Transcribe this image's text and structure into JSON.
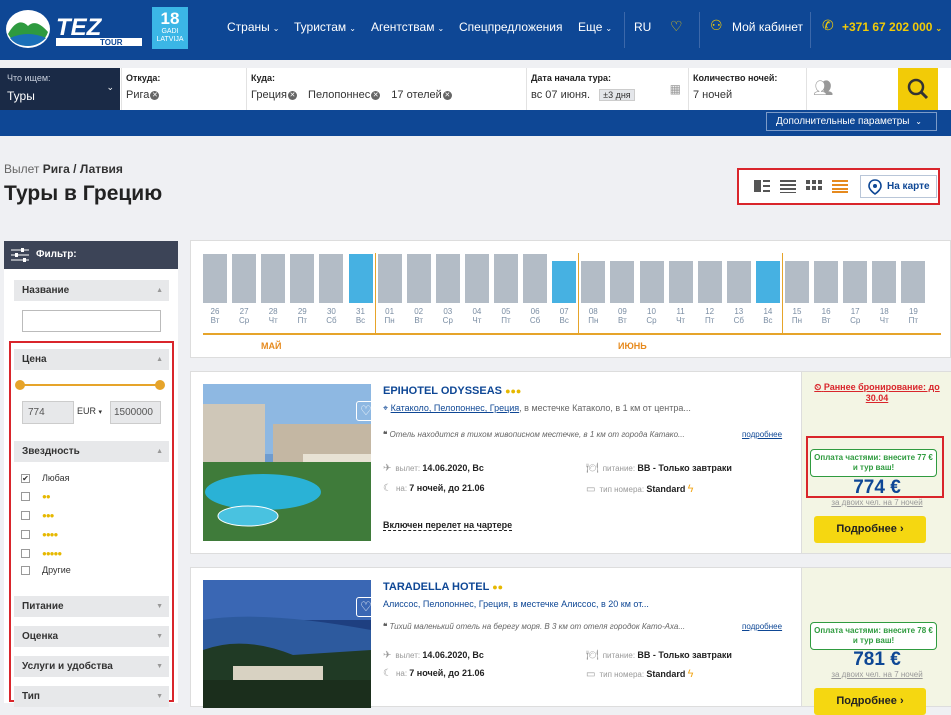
{
  "header": {
    "logo_text": "TEZ TOUR",
    "anniversary_num": "18",
    "anniversary_word": "GADI",
    "anniversary_country": "LATVIJA",
    "nav": [
      "Страны",
      "Туристам",
      "Агентствам",
      "Спецпредложения",
      "Еще"
    ],
    "lang": "RU",
    "cabinet": "Мой кабинет",
    "phone": "+371 67 202 000"
  },
  "search": {
    "what_label": "Что ищем:",
    "what_value": "Туры",
    "from_label": "Откуда:",
    "from_value": "Рига",
    "to_label": "Куда:",
    "to_values": [
      "Греция",
      "Пелопоннес",
      "17 отелей"
    ],
    "date_label": "Дата начала тура:",
    "date_value": "вс 07 июня.",
    "date_flex": "±3 дня",
    "nights_label": "Количество ночей:",
    "nights_value": "7 ночей",
    "advanced": "Дополнительные параметры"
  },
  "breadcrumb": {
    "prefix": "Вылет",
    "city": "Рига",
    "sep": "/",
    "country": "Латвия"
  },
  "page_title": "Туры в Грецию",
  "views": {
    "map_label": "На карте"
  },
  "filter": {
    "title": "Фильтр:",
    "name_section": "Название",
    "price_section": "Цена",
    "price_min": "774",
    "currency": "EUR",
    "price_max": "1500000",
    "stars_section": "Звездность",
    "star_any": "Любая",
    "star_other": "Другие",
    "meal_section": "Питание",
    "rating_section": "Оценка",
    "services_section": "Услуги и удобства",
    "type_section": "Тип"
  },
  "calendar": {
    "months": [
      "МАЙ",
      "ИЮНЬ"
    ],
    "days": [
      {
        "d": "26",
        "w": "Вт",
        "v": 0.82,
        "s": false
      },
      {
        "d": "27",
        "w": "Ср",
        "v": 0.82,
        "s": false
      },
      {
        "d": "28",
        "w": "Чт",
        "v": 0.82,
        "s": false
      },
      {
        "d": "29",
        "w": "Пт",
        "v": 0.82,
        "s": false
      },
      {
        "d": "30",
        "w": "Сб",
        "v": 0.82,
        "s": false
      },
      {
        "d": "31",
        "w": "Вс",
        "v": 0.82,
        "s": true
      },
      {
        "d": "01",
        "w": "Пн",
        "v": 0.82,
        "s": false
      },
      {
        "d": "02",
        "w": "Вт",
        "v": 0.82,
        "s": false
      },
      {
        "d": "03",
        "w": "Ср",
        "v": 0.82,
        "s": false
      },
      {
        "d": "04",
        "w": "Чт",
        "v": 0.82,
        "s": false
      },
      {
        "d": "05",
        "w": "Пт",
        "v": 0.82,
        "s": false
      },
      {
        "d": "06",
        "w": "Сб",
        "v": 0.82,
        "s": false
      },
      {
        "d": "07",
        "w": "Вс",
        "v": 0.7,
        "s": true
      },
      {
        "d": "08",
        "w": "Пн",
        "v": 0.7,
        "s": false
      },
      {
        "d": "09",
        "w": "Вт",
        "v": 0.7,
        "s": false
      },
      {
        "d": "10",
        "w": "Ср",
        "v": 0.7,
        "s": false
      },
      {
        "d": "11",
        "w": "Чт",
        "v": 0.7,
        "s": false
      },
      {
        "d": "12",
        "w": "Пт",
        "v": 0.7,
        "s": false
      },
      {
        "d": "13",
        "w": "Сб",
        "v": 0.7,
        "s": false
      },
      {
        "d": "14",
        "w": "Вс",
        "v": 0.7,
        "s": true
      },
      {
        "d": "15",
        "w": "Пн",
        "v": 0.7,
        "s": false
      },
      {
        "d": "16",
        "w": "Вт",
        "v": 0.7,
        "s": false
      },
      {
        "d": "17",
        "w": "Ср",
        "v": 0.7,
        "s": false
      },
      {
        "d": "18",
        "w": "Чт",
        "v": 0.7,
        "s": false
      },
      {
        "d": "19",
        "w": "Пт",
        "v": 0.7,
        "s": false
      }
    ]
  },
  "hotels": [
    {
      "name": "EPIHOTEL ODYSSEAS",
      "stars": 3,
      "location_link": "Катаколо, Пелопоннес, Греция",
      "location_rest": ", в местечке Катаколо, в 1 км от центра...",
      "desc": "Отель находится в тихом живописном местечке, в 1 км от города Катако...",
      "more": "подробнее",
      "dep_label": "вылет:",
      "dep_value": "14.06.2020, Вс",
      "nights_label": "на:",
      "nights_value": "7 ночей, до 21.06",
      "meal_label": "питание:",
      "meal_value": "BB - Только завтраки",
      "room_label": "тип номера:",
      "room_value": "Standard",
      "charter": "Включен перелет на чартере",
      "early": "Раннее бронирование: до 30.04",
      "installment": "Оплата частями: внесите 77 € и тур ваш!",
      "price": "774 €",
      "price_note": "за двоих чел. на 7 ночей",
      "details": "Подробнее ›"
    },
    {
      "name": "TARADELLA HOTEL",
      "stars": 2,
      "location_link": "",
      "location_rest": "Алиссос, Пелопоннес, Греция, в местечке Алиссос, в 20 км от...",
      "desc": "Тихий маленький отель на берегу моря. В 3 км от отеля городок Като-Аха...",
      "more": "подробнее",
      "dep_label": "вылет:",
      "dep_value": "14.06.2020, Вс",
      "nights_label": "на:",
      "nights_value": "7 ночей, до 21.06",
      "meal_label": "питание:",
      "meal_value": "BB - Только завтраки",
      "room_label": "тип номера:",
      "room_value": "Standard",
      "installment": "Оплата частями: внесите 78 € и тур ваш!",
      "price": "781 €",
      "price_note": "за двоих чел. на 7 ночей",
      "details": "Подробнее ›"
    }
  ],
  "colors": {
    "brand": "#0e4795",
    "accent_yellow": "#f2cb07",
    "selected_bar": "#46b1e2",
    "highlight_red": "#d9252b"
  }
}
